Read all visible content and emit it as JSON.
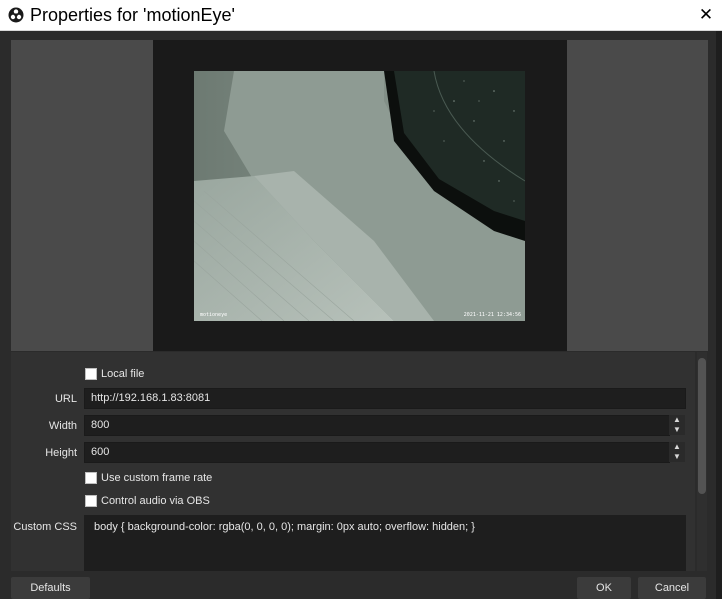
{
  "window": {
    "title": "Properties for 'motionEye'",
    "close_glyph": "✕"
  },
  "preview": {
    "camera_timestamp_left": "motioneye",
    "camera_timestamp_right": "2021-11-21 12:34:56"
  },
  "form": {
    "local_file_label": "Local file",
    "url_label": "URL",
    "url_value": "http://192.168.1.83:8081",
    "width_label": "Width",
    "width_value": "800",
    "height_label": "Height",
    "height_value": "600",
    "custom_frame_rate_label": "Use custom frame rate",
    "control_audio_label": "Control audio via OBS",
    "custom_css_label": "Custom CSS",
    "custom_css_value": "body { background-color: rgba(0, 0, 0, 0); margin: 0px auto; overflow: hidden; }"
  },
  "buttons": {
    "defaults": "Defaults",
    "ok": "OK",
    "cancel": "Cancel"
  },
  "icons": {
    "app_icon": "obs-logo-icon",
    "spin_up": "chevron-up-icon",
    "spin_down": "chevron-down-icon"
  }
}
